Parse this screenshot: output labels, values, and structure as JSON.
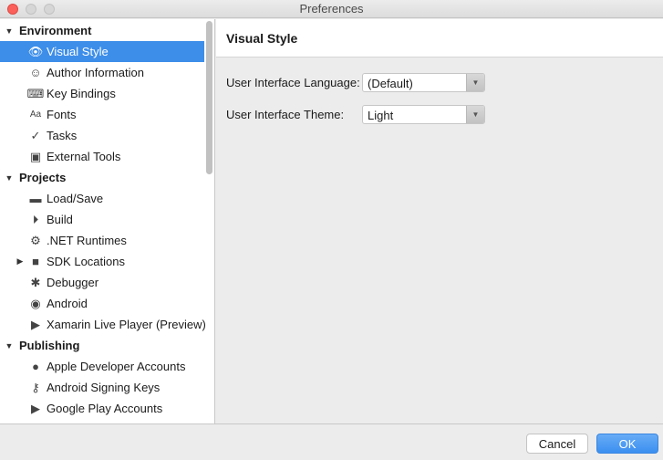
{
  "window": {
    "title": "Preferences"
  },
  "sidebar": {
    "rows": [
      {
        "kind": "group",
        "label": "Environment",
        "expanded": true
      },
      {
        "kind": "item",
        "label": "Visual Style",
        "icon": "eye-icon",
        "glyph": "👁",
        "selected": true
      },
      {
        "kind": "item",
        "label": "Author Information",
        "icon": "smiley-icon",
        "glyph": "☺"
      },
      {
        "kind": "item",
        "label": "Key Bindings",
        "icon": "keyboard-icon",
        "glyph": "⌨"
      },
      {
        "kind": "item",
        "label": "Fonts",
        "icon": "font-icon",
        "glyph": "Aa"
      },
      {
        "kind": "item",
        "label": "Tasks",
        "icon": "checkmark-icon",
        "glyph": "✓"
      },
      {
        "kind": "item",
        "label": "External Tools",
        "icon": "terminal-icon",
        "glyph": "▣"
      },
      {
        "kind": "group",
        "label": "Projects",
        "expanded": true
      },
      {
        "kind": "item",
        "label": "Load/Save",
        "icon": "drive-icon",
        "glyph": "▬"
      },
      {
        "kind": "item",
        "label": "Build",
        "icon": "build-icon",
        "glyph": "⏵"
      },
      {
        "kind": "item",
        "label": ".NET Runtimes",
        "icon": "gear-icon",
        "glyph": "⚙"
      },
      {
        "kind": "item",
        "label": "SDK Locations",
        "icon": "folder-icon",
        "glyph": "■",
        "collapsed": true
      },
      {
        "kind": "item",
        "label": "Debugger",
        "icon": "bug-icon",
        "glyph": "✱"
      },
      {
        "kind": "item",
        "label": "Android",
        "icon": "android-icon",
        "glyph": "◉"
      },
      {
        "kind": "item",
        "label": "Xamarin Live Player (Preview)",
        "icon": "play-icon",
        "glyph": "▶"
      },
      {
        "kind": "group",
        "label": "Publishing",
        "expanded": true
      },
      {
        "kind": "item",
        "label": "Apple Developer Accounts",
        "icon": "apple-icon",
        "glyph": "●"
      },
      {
        "kind": "item",
        "label": "Android Signing Keys",
        "icon": "key-icon",
        "glyph": "⚷"
      },
      {
        "kind": "item",
        "label": "Google Play Accounts",
        "icon": "google-play-icon",
        "glyph": "▶"
      }
    ]
  },
  "panel": {
    "title": "Visual Style",
    "language": {
      "label": "User Interface Language:",
      "value": "(Default)"
    },
    "theme": {
      "label": "User Interface Theme:",
      "value": "Light"
    }
  },
  "footer": {
    "cancel_label": "Cancel",
    "ok_label": "OK"
  },
  "colors": {
    "selection": "#3d8ee9",
    "ok_button": "#3b8ff0"
  }
}
